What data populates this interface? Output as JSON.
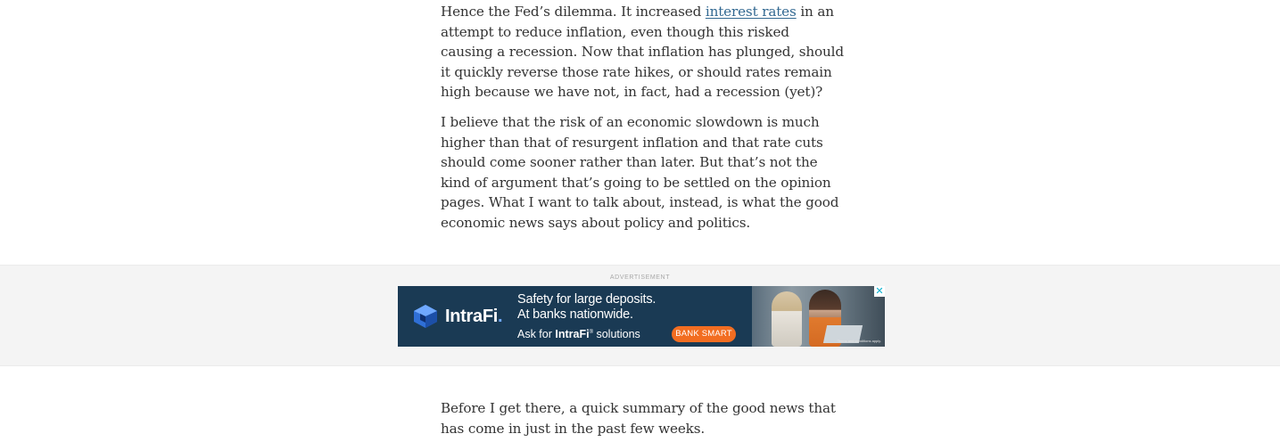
{
  "article": {
    "p1": {
      "before_link": "Hence the Fed’s dilemma. It increased ",
      "link_text": "interest rates",
      "after_link": " in an attempt to reduce inflation, even though this risked causing a recession. Now that inflation has plunged, should it quickly reverse those rate hikes, or should rates remain high because we have not, in fact, had a recession (yet)?"
    },
    "p2": "I believe that the risk of an economic slowdown is much higher than that of resurgent inflation and that rate cuts should come sooner rather than later. But that’s not the kind of argument that’s going to be settled on the opinion pages. What I want to talk about, instead, is what the good economic news says about policy and politics.",
    "p3": "Before I get there, a quick summary of the good news that has come in just in the past few weeks."
  },
  "ad": {
    "label": "ADVERTISEMENT",
    "brand": "IntraFi",
    "brand_mark": ".",
    "headline_1": "Safety for large deposits.",
    "headline_2": "At banks nationwide.",
    "sub_prefix": "Ask for ",
    "sub_brand": "IntraFi",
    "sub_reg": "®",
    "sub_suffix": " solutions",
    "cta": "BANK SMART",
    "fine_print": "Terms and conditions apply.",
    "close_glyph": "✕",
    "colors": {
      "banner_bg": "#1a3a54",
      "cta_bg": "#f26d21",
      "logo_blue": "#2f6fd6"
    }
  },
  "colors": {
    "link": "#326891",
    "body_text": "#333333",
    "ad_band_bg": "#f4f4f4"
  }
}
